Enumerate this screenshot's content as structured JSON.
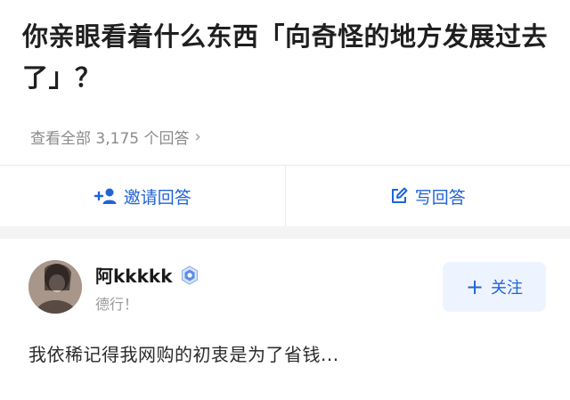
{
  "question": {
    "title": "你亲眼看着什么东西「向奇怪的地方发展过去了」？",
    "view_all": "查看全部 3,175 个回答",
    "view_all_chevron": "›"
  },
  "actions": {
    "invite_label": "邀请回答",
    "invite_icon": "add-user-icon",
    "write_label": "写回答",
    "write_icon": "edit-icon"
  },
  "answer": {
    "author_name": "阿kkkkk",
    "author_bio": "德行！",
    "badge_icon": "verified-badge-icon",
    "follow_label": "关注",
    "follow_plus": "+",
    "excerpt": "我依稀记得我网购的初衷是为了省钱..."
  },
  "colors": {
    "accent": "#1f63d8",
    "follow_bg": "#eef4ff",
    "muted": "#8a8a8a",
    "divider": "#ececec"
  }
}
